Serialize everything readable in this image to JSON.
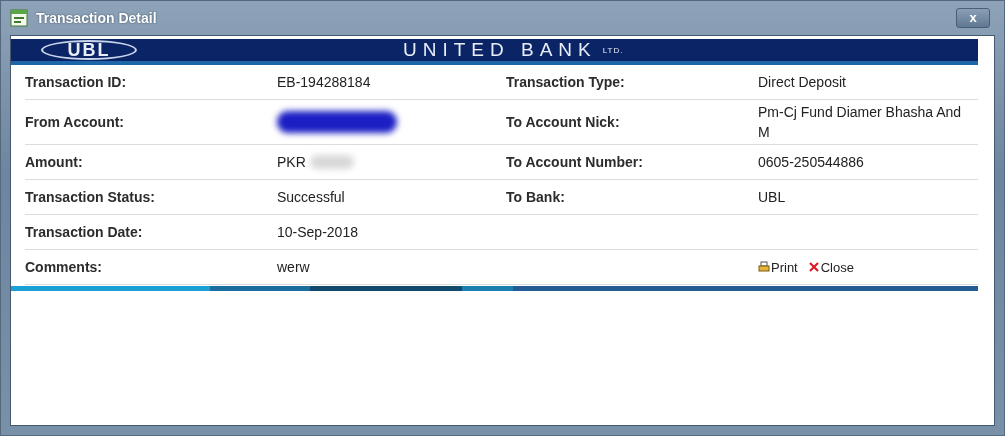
{
  "window": {
    "title": "Transaction Detail",
    "close_label": "x"
  },
  "banner": {
    "logo": "UBL",
    "name": "UNITED BANK",
    "suffix": "LTD."
  },
  "rows": [
    {
      "left": {
        "label": "Transaction ID:",
        "value": "EB-194288184"
      },
      "right": {
        "label": "Transaction Type:",
        "value": "Direct Deposit"
      }
    },
    {
      "left": {
        "label": "From Account:",
        "redacted": true
      },
      "right": {
        "label": "To Account Nick:",
        "value": "Pm-Cj Fund Diamer Bhasha And M"
      }
    },
    {
      "left": {
        "label": "Amount:",
        "value": "PKR",
        "redacted": true
      },
      "right": {
        "label": "To Account Number:",
        "value": "0605-250544886"
      }
    },
    {
      "left": {
        "label": "Transaction Status:",
        "value": "Successful"
      },
      "right": {
        "label": "To Bank:",
        "value": "UBL"
      }
    },
    {
      "left": {
        "label": "Transaction Date:",
        "value": "10-Sep-2018"
      }
    },
    {
      "left": {
        "label": "Comments:",
        "value": "werw"
      },
      "actions": [
        {
          "kind": "print",
          "label": "Print"
        },
        {
          "kind": "close",
          "label": "Close"
        }
      ]
    }
  ]
}
